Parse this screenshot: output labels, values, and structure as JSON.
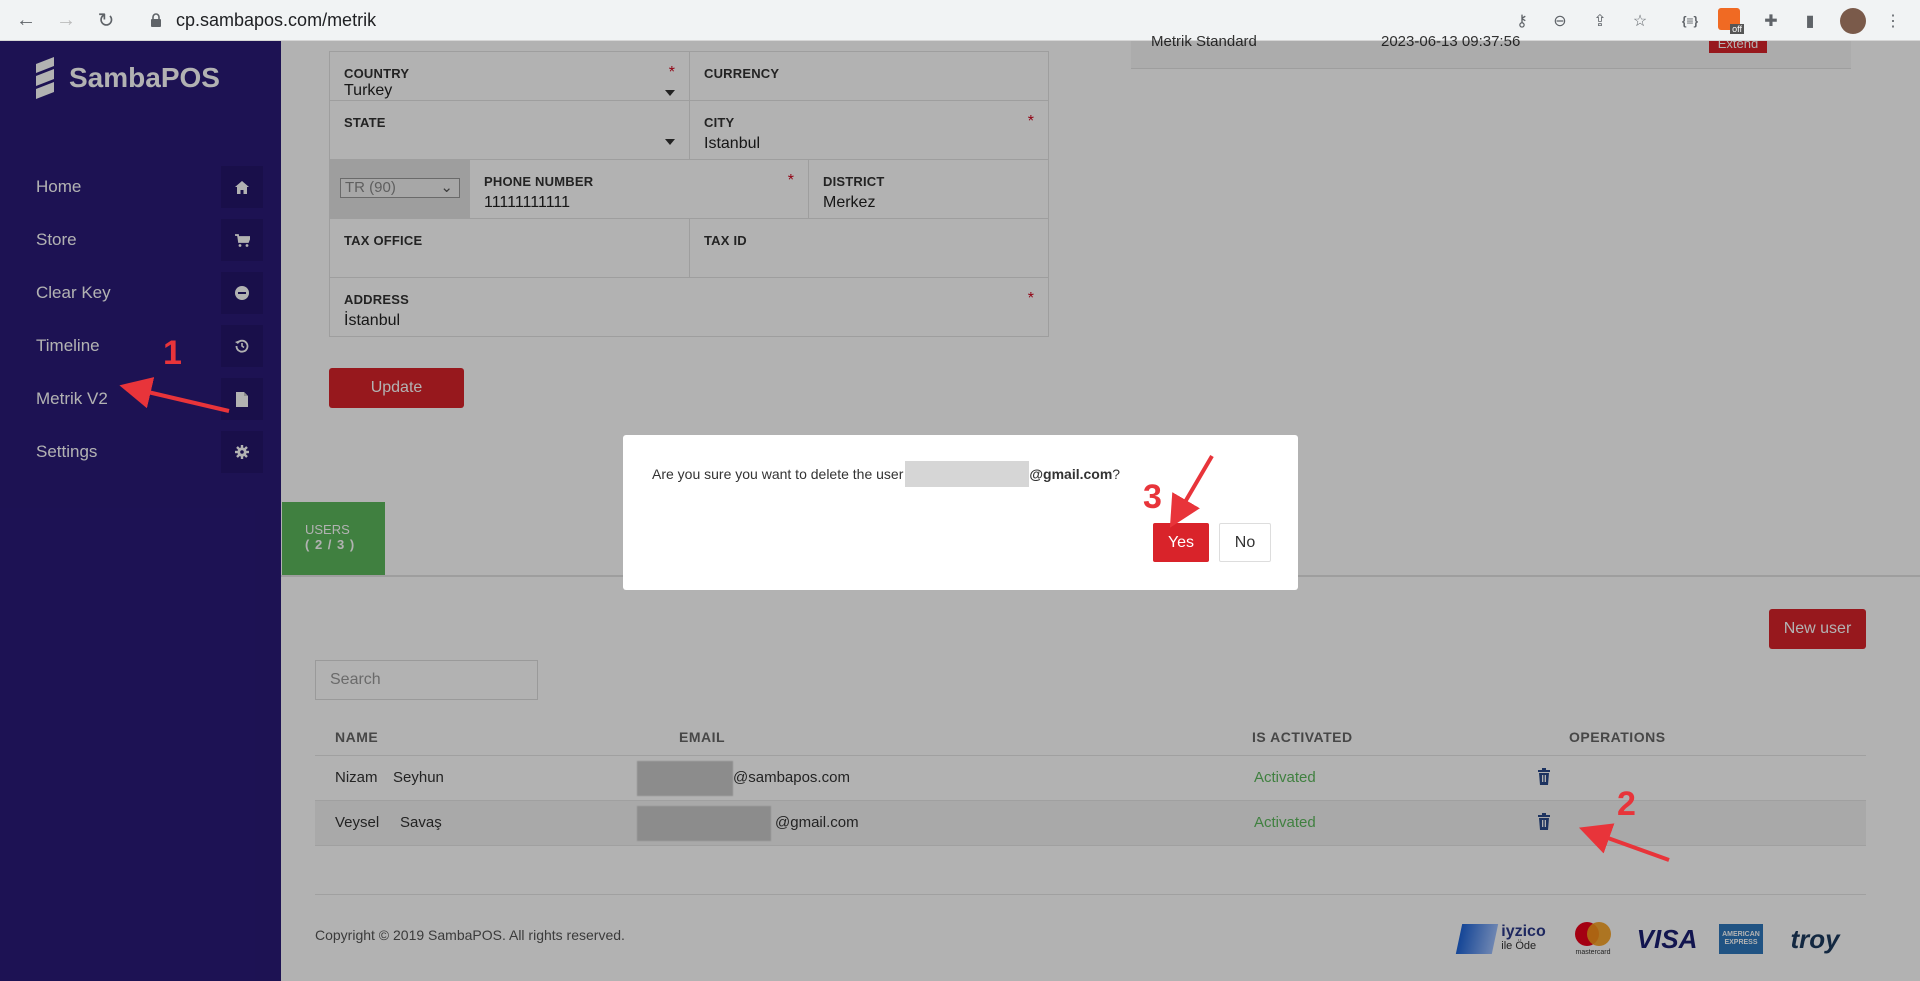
{
  "browser": {
    "url": "cp.sambapos.com/metrik",
    "ext_badge": "off"
  },
  "sidebar": {
    "brand": "SambaPOS",
    "items": [
      {
        "label": "Home",
        "icon": "home-icon"
      },
      {
        "label": "Store",
        "icon": "cart-icon"
      },
      {
        "label": "Clear Key",
        "icon": "minus-circle-icon"
      },
      {
        "label": "Timeline",
        "icon": "history-icon"
      },
      {
        "label": "Metrik V2",
        "icon": "file-icon"
      },
      {
        "label": "Settings",
        "icon": "gear-icon"
      }
    ]
  },
  "form": {
    "country": {
      "label": "COUNTRY",
      "value": "Turkey"
    },
    "currency": {
      "label": "CURRENCY",
      "value": ""
    },
    "state": {
      "label": "STATE",
      "value": ""
    },
    "city": {
      "label": "CITY",
      "value": "Istanbul"
    },
    "phone_code": "TR (90)",
    "phone": {
      "label": "PHONE NUMBER",
      "value": "11111111111"
    },
    "district": {
      "label": "DISTRICT",
      "value": "Merkez"
    },
    "tax_office": {
      "label": "TAX OFFICE",
      "value": ""
    },
    "tax_id": {
      "label": "TAX ID",
      "value": ""
    },
    "address": {
      "label": "ADDRESS",
      "value": "İstanbul"
    },
    "update_label": "Update",
    "required_mark": "*"
  },
  "license_row": {
    "product": "Metrik Standard",
    "date": "2023-06-13 09:37:56",
    "badge": "Extend"
  },
  "users": {
    "tab_label": "USERS",
    "tab_count": "( 2 / 3 )",
    "new_user_label": "New user",
    "search_placeholder": "Search",
    "columns": [
      "NAME",
      "EMAIL",
      "IS ACTIVATED",
      "OPERATIONS"
    ],
    "rows": [
      {
        "first": "Nizam",
        "last": "Seyhun",
        "email_suffix": "@sambapos.com",
        "status": "Activated"
      },
      {
        "first": "Veysel",
        "last": "Savaş",
        "email_suffix": "@gmail.com",
        "status": "Activated"
      }
    ]
  },
  "footer": {
    "copyright": "Copyright © 2019 SambaPOS. All rights reserved.",
    "payments": [
      "iyzico",
      "ile Öde",
      "mastercard",
      "VISA",
      "AMERICAN EXPRESS",
      "troy"
    ]
  },
  "modal": {
    "text_before": "Are you sure you want to delete the user",
    "email_suffix": "@gmail.com",
    "text_after": "?",
    "yes_label": "Yes",
    "no_label": "No"
  },
  "annotations": [
    "1",
    "2",
    "3"
  ],
  "colors": {
    "sidebar": "#2a1a78",
    "accent_red": "#d9232a",
    "success_green": "#5cb85c"
  }
}
